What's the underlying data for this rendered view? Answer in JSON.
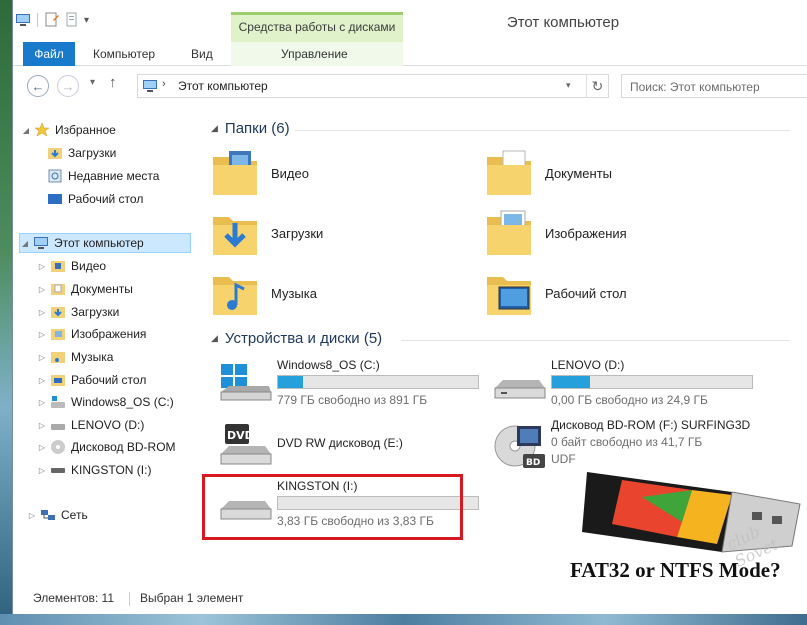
{
  "window": {
    "title": "Этот компьютер",
    "context_tab": "Средства работы с дисками"
  },
  "ribbon": {
    "tabs": [
      "Файл",
      "Компьютер",
      "Вид",
      "Управление"
    ],
    "file_color": "#1979ca",
    "context_color": "#dff2c9"
  },
  "address": {
    "path": "Этот компьютер",
    "search_placeholder": "Поиск: Этот компьютер"
  },
  "navpane": {
    "favorites": {
      "label": "Избранное",
      "items": [
        "Загрузки",
        "Недавние места",
        "Рабочий стол"
      ]
    },
    "computer": {
      "label": "Этот компьютер",
      "items": [
        "Видео",
        "Документы",
        "Загрузки",
        "Изображения",
        "Музыка",
        "Рабочий стол",
        "Windows8_OS (C:)",
        "LENOVO (D:)",
        "Дисковод BD-ROM",
        "KINGSTON (I:)"
      ]
    },
    "network": {
      "label": "Сеть"
    }
  },
  "folders": {
    "header": "Папки (6)",
    "items": [
      {
        "label": "Видео",
        "icon": "video-folder-icon"
      },
      {
        "label": "Документы",
        "icon": "documents-folder-icon"
      },
      {
        "label": "Загрузки",
        "icon": "downloads-folder-icon"
      },
      {
        "label": "Изображения",
        "icon": "pictures-folder-icon"
      },
      {
        "label": "Музыка",
        "icon": "music-folder-icon"
      },
      {
        "label": "Рабочий стол",
        "icon": "desktop-folder-icon"
      }
    ]
  },
  "drives": {
    "header": "Устройства и диски (5)",
    "items": [
      {
        "name": "Windows8_OS (C:)",
        "free": "779 ГБ свободно из 891 ГБ",
        "used_fraction": 0.126
      },
      {
        "name": "LENOVO (D:)",
        "free": "0,00 ГБ свободно из 24,9 ГБ",
        "used_fraction": 0.19
      },
      {
        "name": "DVD RW дисковод (E:)"
      },
      {
        "name": "Дисковод BD-ROM (F:) SURFING3D",
        "free": "0 байт свободно из 41,7 ГБ",
        "fs": "UDF"
      },
      {
        "name": "KINGSTON (I:)",
        "free": "3,83 ГБ свободно из 3,83 ГБ",
        "used_fraction": 0.0
      }
    ],
    "bar_color": "#26a0da"
  },
  "promo": {
    "text": "FAT32 or NTFS Mode?",
    "watermark": "club Sovet"
  },
  "status": {
    "count": "Элементов: 11",
    "selected": "Выбран 1 элемент"
  },
  "highlight_color": "#d71920"
}
